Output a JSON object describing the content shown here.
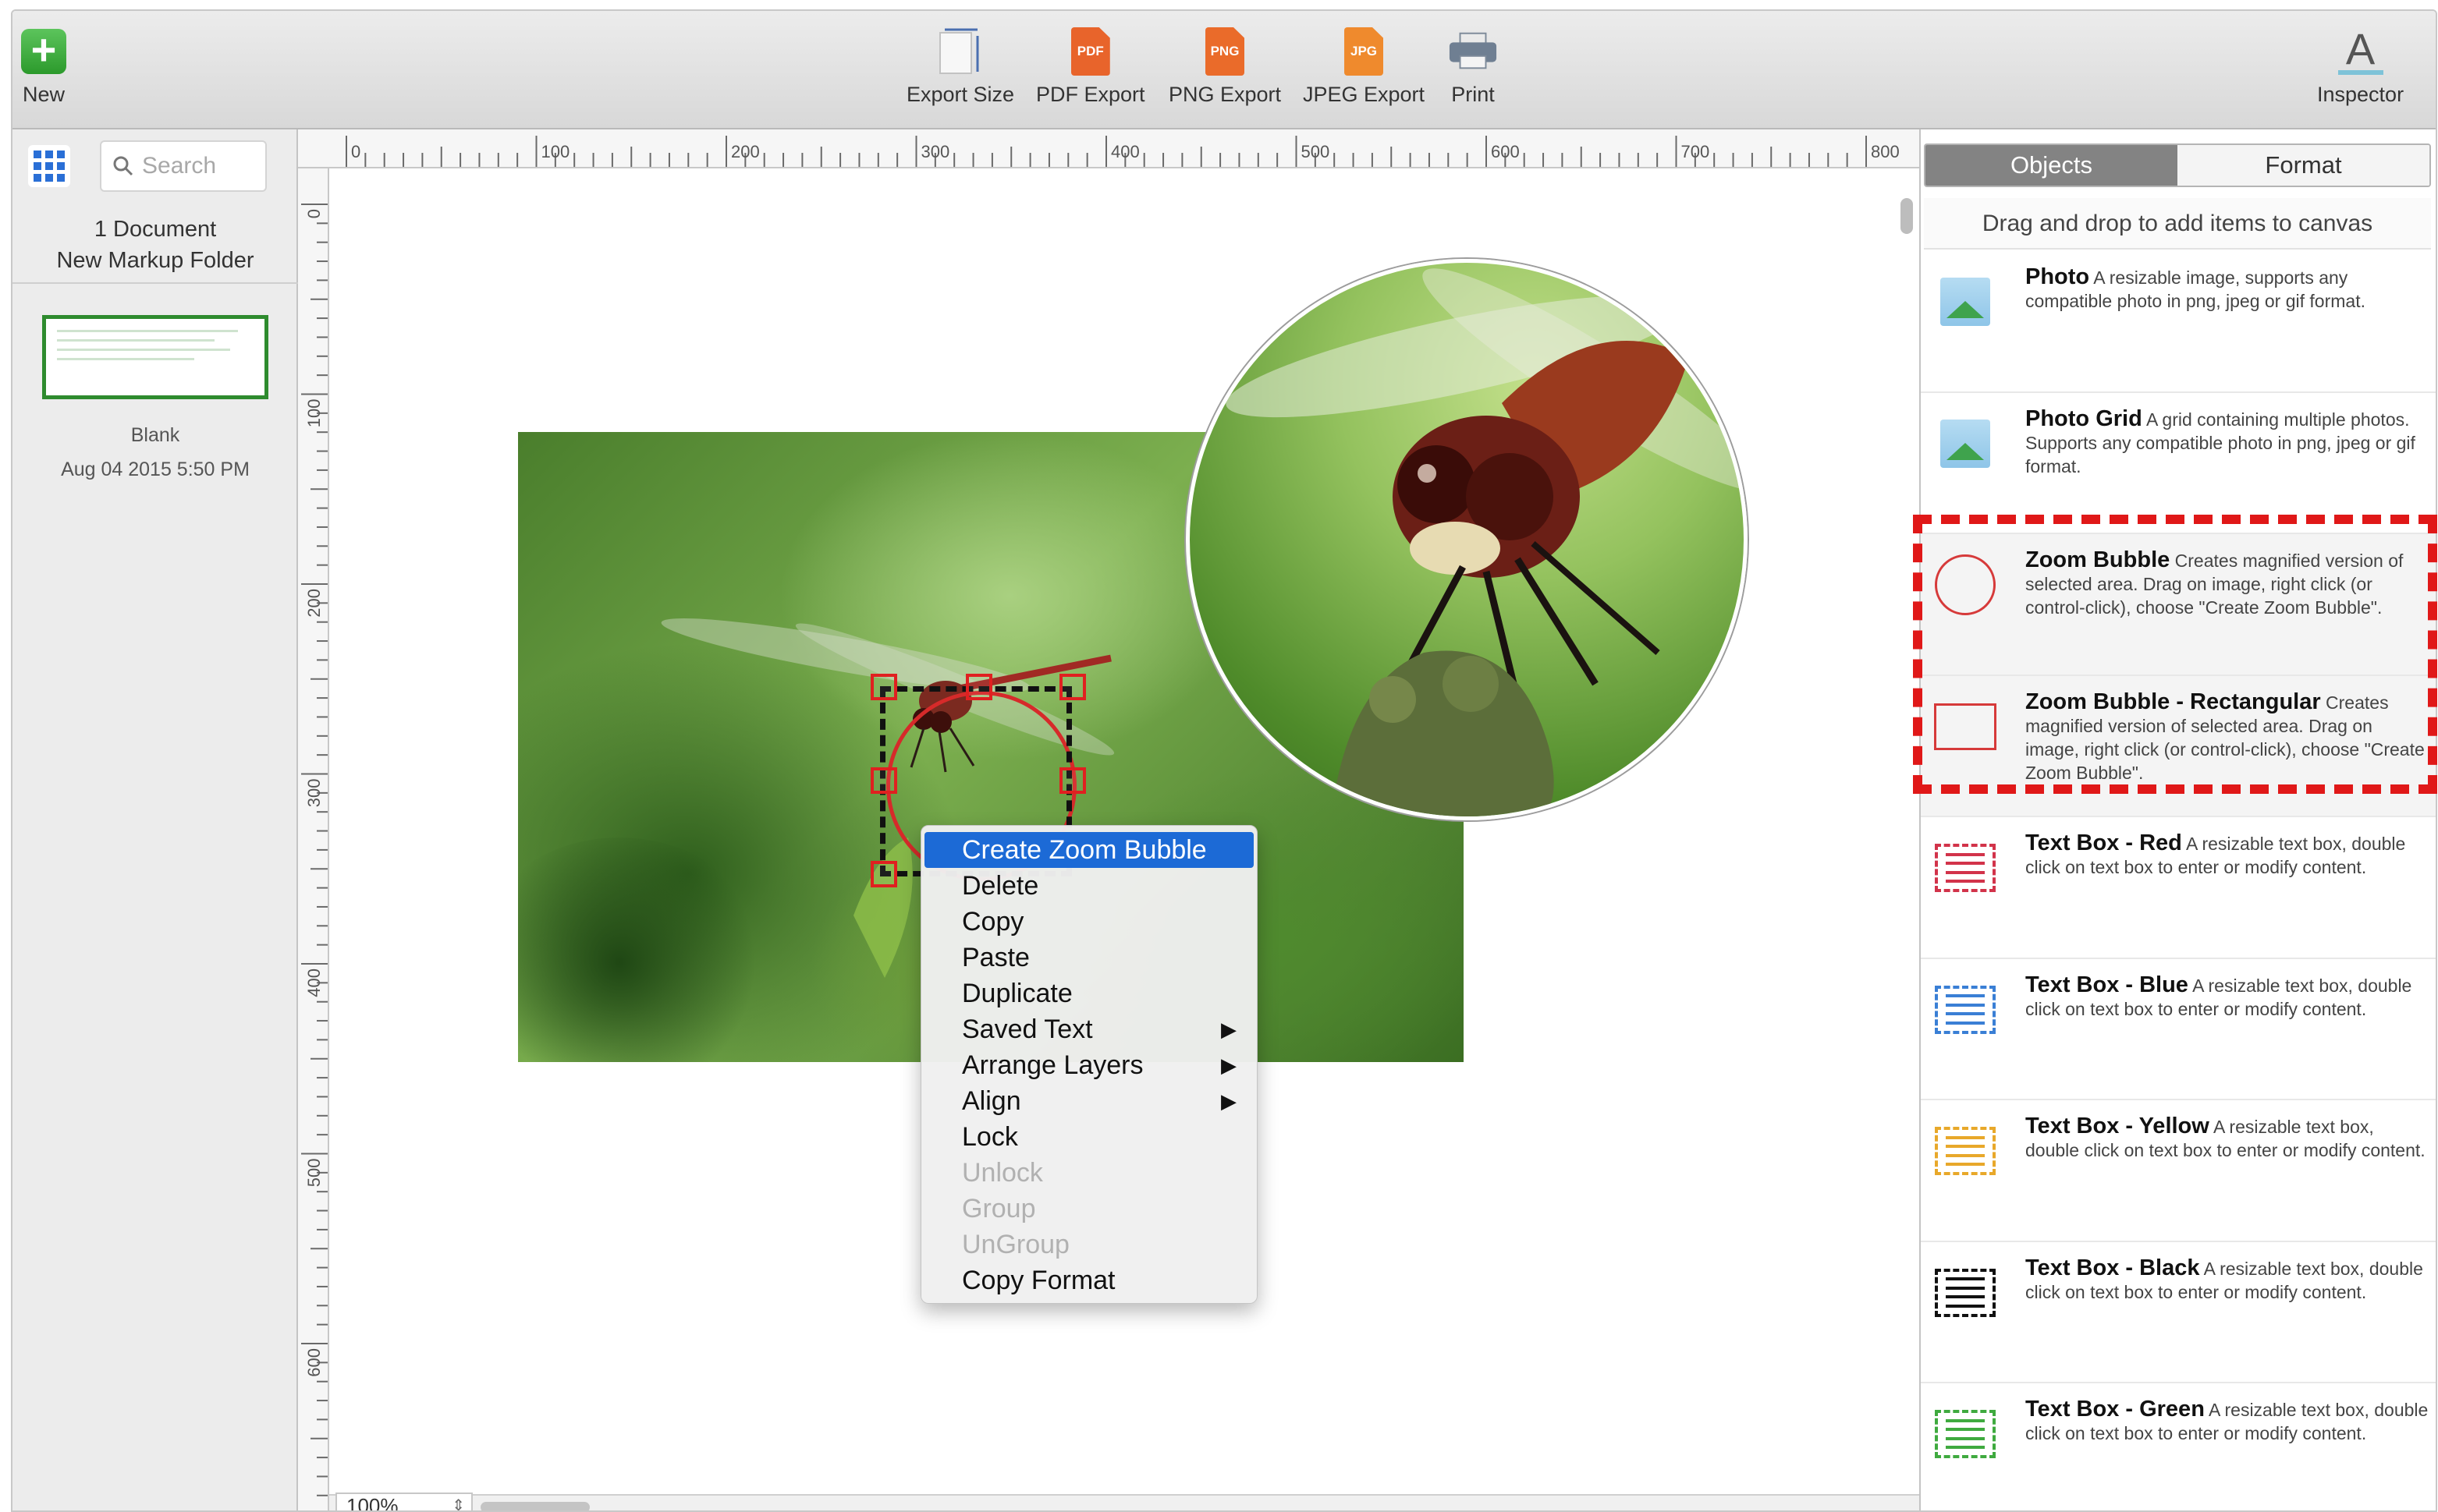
{
  "toolbar": {
    "new_label": "New",
    "export_size_label": "Export Size",
    "pdf_export_label": "PDF Export",
    "pdf_badge": "PDF",
    "png_export_label": "PNG Export",
    "png_badge": "PNG",
    "jpeg_export_label": "JPEG Export",
    "jpeg_badge": "JPG",
    "print_label": "Print",
    "inspector_label": "Inspector",
    "inspector_glyph": "A"
  },
  "sidebar": {
    "search_placeholder": "Search",
    "doc_count": "1 Document",
    "folder_name": "New Markup Folder",
    "document": {
      "name": "Blank",
      "date": "Aug 04 2015 5:50 PM"
    }
  },
  "rulers": {
    "top_labels": [
      "0",
      "100",
      "200",
      "300",
      "400",
      "500",
      "600",
      "700",
      "800"
    ],
    "left_labels": [
      "0",
      "100",
      "200",
      "300",
      "400",
      "500",
      "600"
    ]
  },
  "canvas": {
    "zoom": "100%"
  },
  "context_menu": {
    "items": [
      {
        "label": "Create Zoom Bubble",
        "state": "highlighted",
        "submenu": false
      },
      {
        "label": "Delete",
        "state": "enabled",
        "submenu": false
      },
      {
        "label": "Copy",
        "state": "enabled",
        "submenu": false
      },
      {
        "label": "Paste",
        "state": "enabled",
        "submenu": false
      },
      {
        "label": "Duplicate",
        "state": "enabled",
        "submenu": false
      },
      {
        "label": "Saved Text",
        "state": "enabled",
        "submenu": true
      },
      {
        "label": "Arrange Layers",
        "state": "enabled",
        "submenu": true
      },
      {
        "label": "Align",
        "state": "enabled",
        "submenu": true
      },
      {
        "label": "Lock",
        "state": "enabled",
        "submenu": false
      },
      {
        "label": "Unlock",
        "state": "disabled",
        "submenu": false
      },
      {
        "label": "Group",
        "state": "disabled",
        "submenu": false
      },
      {
        "label": "UnGroup",
        "state": "disabled",
        "submenu": false
      },
      {
        "label": "Copy Format",
        "state": "enabled",
        "submenu": false
      }
    ],
    "submenu_glyph": "▶"
  },
  "inspector": {
    "tabs": [
      {
        "label": "Objects",
        "active": true
      },
      {
        "label": "Format",
        "active": false
      }
    ],
    "hint": "Drag and drop to add items to canvas",
    "objects": [
      {
        "name": "Photo",
        "description": "A resizable image, supports any compatible photo in png, jpeg or gif format.",
        "icon": "photo-icon"
      },
      {
        "name": "Photo Grid",
        "description": "A grid containing multiple photos.  Supports any compatible photo in png, jpeg or gif format.",
        "icon": "photo-grid-icon"
      },
      {
        "name": "Zoom Bubble",
        "description": "Creates magnified version of selected area. Drag on image, right click (or control-click), choose \"Create Zoom Bubble\".",
        "icon": "zoom-bubble-circle-icon"
      },
      {
        "name": "Zoom Bubble - Rectangular",
        "description": "Creates magnified version of selected area.  Drag on image, right click (or control-click), choose \"Create Zoom Bubble\".",
        "icon": "zoom-bubble-rectangle-icon"
      },
      {
        "name": "Text Box - Red",
        "description": "A resizable text box, double click on text box to enter or modify content.",
        "icon": "text-box-red-icon"
      },
      {
        "name": "Text Box - Blue",
        "description": "A resizable text box, double click on text box to enter or modify content.",
        "icon": "text-box-blue-icon"
      },
      {
        "name": "Text Box - Yellow",
        "description": "A resizable text box, double click on text box to enter or modify content.",
        "icon": "text-box-yellow-icon"
      },
      {
        "name": "Text Box - Black",
        "description": "A resizable text box, double click on text box to enter or modify content.",
        "icon": "text-box-black-icon"
      },
      {
        "name": "Text Box - Green",
        "description": "A resizable text box, double click on text box to enter or modify content.",
        "icon": "text-box-green-icon"
      }
    ]
  },
  "colors": {
    "accent_blue": "#1c6ad6",
    "selection_red": "#e02020",
    "highlight_dash_red": "#e01818",
    "text_box_red": "#d2334a",
    "text_box_blue": "#3a7fd5",
    "text_box_yellow": "#e8a82a",
    "text_box_black": "#111111",
    "text_box_green": "#3faa3f"
  }
}
